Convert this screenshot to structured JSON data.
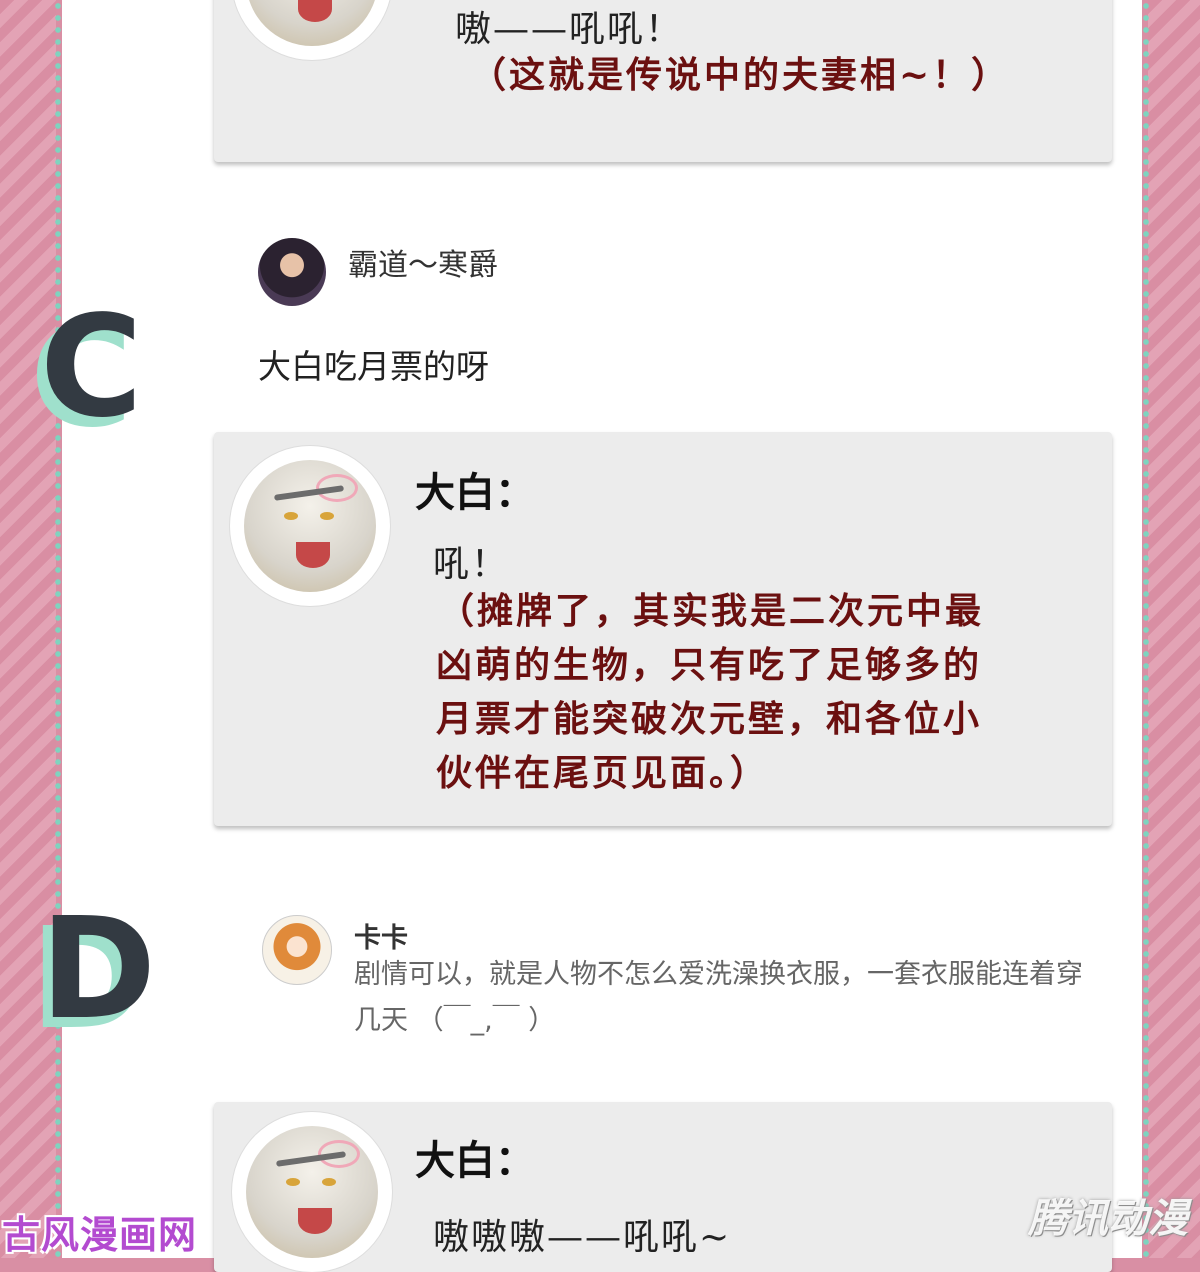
{
  "top_bubble": {
    "roar": "嗷——吼吼！",
    "note": "（这就是传说中的夫妻相~！）"
  },
  "section_c": {
    "letter": "C",
    "comment": {
      "username": "霸道～寒爵",
      "text": "大白吃月票的呀"
    },
    "reply": {
      "speaker": "大白：",
      "roar": "吼！",
      "lines": [
        "（摊牌了，其实我是二次元中最",
        "凶萌的生物，只有吃了足够多的",
        "月票才能突破次元壁，和各位小",
        "伙伴在尾页见面。）"
      ]
    }
  },
  "section_d": {
    "letter": "D",
    "comment": {
      "username": "卡卡",
      "text": "剧情可以，就是人物不怎么爱洗澡换衣服，一套衣服能连着穿几天 （￣_,￣ ）"
    },
    "reply": {
      "speaker": "大白：",
      "roar": "嗷嗷嗷——吼吼~"
    }
  },
  "watermarks": {
    "left": "古风漫画网",
    "right": "腾讯动漫"
  },
  "colors": {
    "border_pink": "#d98fa4",
    "dot_mint": "#7fd3bf",
    "bubble_gray": "#ececec",
    "dark_red_text": "#6b1010"
  }
}
